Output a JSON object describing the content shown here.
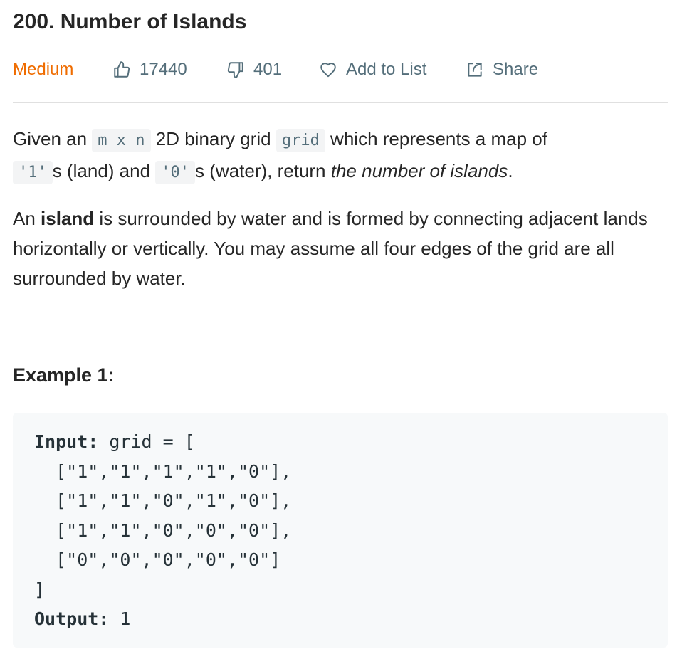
{
  "problem": {
    "title": "200. Number of Islands",
    "difficulty": "Medium",
    "likes": "17440",
    "dislikes": "401",
    "add_to_list": "Add to List",
    "share": "Share"
  },
  "description": {
    "p1": {
      "t1": "Given an ",
      "c1": "m x n",
      "t2": " 2D binary grid ",
      "c2": "grid",
      "t3": " which represents a map of ",
      "c3": "'1'",
      "t4": "s (land) and ",
      "c4": "'0'",
      "t5": "s (water), return ",
      "em": "the number of islands",
      "t6": "."
    },
    "p2": {
      "t1": "An ",
      "bold": "island",
      "t2": " is surrounded by water and is formed by connecting adjacent lands horizontally or vertically. You may assume all four edges of the grid are all surrounded by water."
    }
  },
  "example": {
    "title": "Example 1:",
    "input_label": "Input:",
    "input_first": " grid = [",
    "rows": [
      "  [\"1\",\"1\",\"1\",\"1\",\"0\"],",
      "  [\"1\",\"1\",\"0\",\"1\",\"0\"],",
      "  [\"1\",\"1\",\"0\",\"0\",\"0\"],",
      "  [\"0\",\"0\",\"0\",\"0\",\"0\"]"
    ],
    "close": "]",
    "output_label": "Output:",
    "output_value": " 1"
  },
  "colors": {
    "difficulty": "#ef6c00",
    "meta_text": "#546e7a",
    "text": "#262626",
    "code_bg": "#f7f9fa"
  },
  "icons": [
    "thumbs-up-icon",
    "thumbs-down-icon",
    "heart-icon",
    "share-icon"
  ]
}
